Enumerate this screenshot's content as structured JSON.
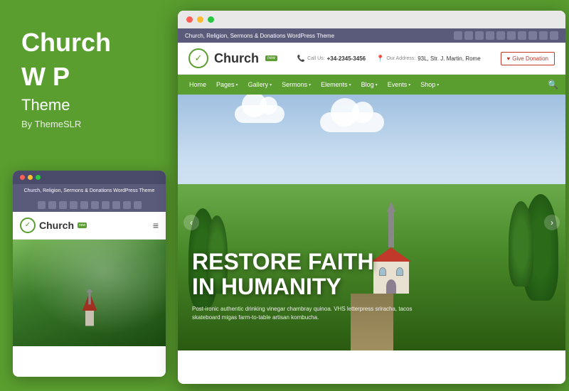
{
  "left": {
    "title_line1": "Church",
    "title_line2": "W P",
    "subtitle": "Theme",
    "author": "By ThemeSLR"
  },
  "mobile": {
    "tagline": "Church, Religion, Sermons & Donations WordPress Theme",
    "logo_text": "Church",
    "logo_badge": "new"
  },
  "browser": {
    "tagline": "Church, Religion, Sermons & Donations WordPress Theme",
    "logo_text": "Church",
    "logo_badge": "new",
    "contact_phone_label": "Call Us:",
    "contact_phone": "+34-2345-3456",
    "contact_address_label": "Our Address:",
    "contact_address": "93L, Str. J. Martin, Rome",
    "donate_btn": "Give Donation",
    "nav": {
      "items": [
        {
          "label": "Home",
          "has_arrow": false
        },
        {
          "label": "Pages",
          "has_arrow": true
        },
        {
          "label": "Gallery",
          "has_arrow": true
        },
        {
          "label": "Sermons",
          "has_arrow": true
        },
        {
          "label": "Elements",
          "has_arrow": true
        },
        {
          "label": "Blog",
          "has_arrow": true
        },
        {
          "label": "Events",
          "has_arrow": true
        },
        {
          "label": "Shop",
          "has_arrow": true
        }
      ]
    },
    "hero": {
      "title_line1": "RESTORE FAITH",
      "title_line2": "IN HUMANITY",
      "description": "Post-ironic authentic drinking vinegar chambray quinoa. VHS letterpress sriracha, tacos skateboard migas farm-to-table artisan kombucha."
    }
  },
  "colors": {
    "green": "#5a9e2f",
    "dark_nav": "#5a5a7a",
    "red_donate": "#c0392b",
    "white": "#ffffff"
  },
  "dots": {
    "red": "#ff5f57",
    "yellow": "#febc2e",
    "green_dot": "#28c840"
  }
}
